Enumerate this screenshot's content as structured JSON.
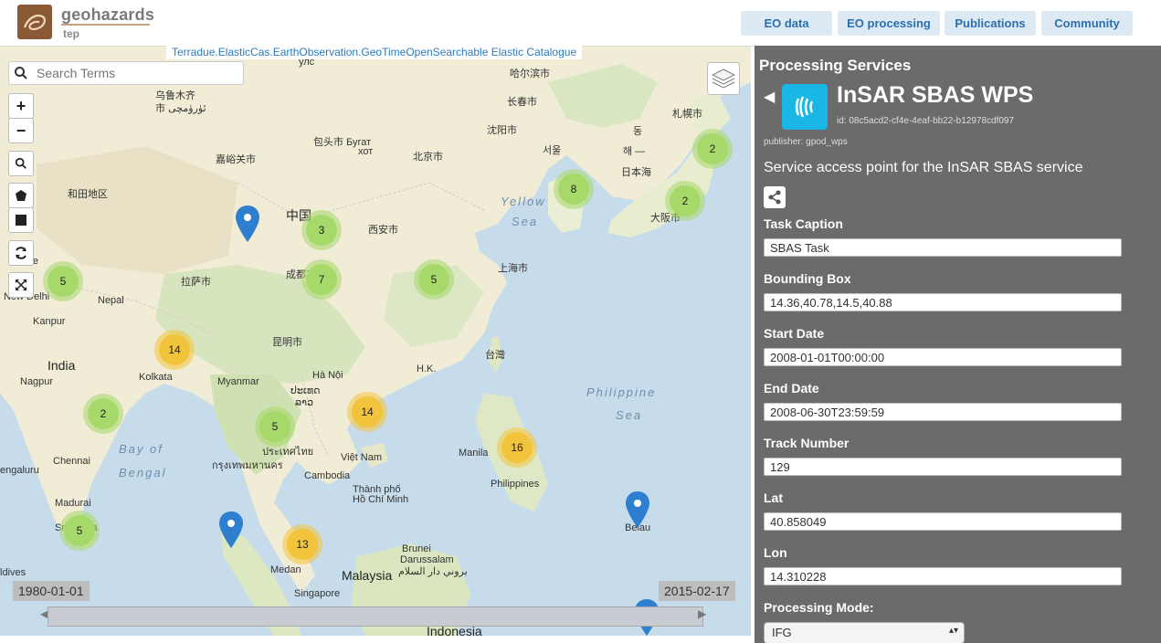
{
  "header": {
    "brand": "geohazards",
    "brand_sub": "tep",
    "nav": [
      "EO data",
      "EO processing",
      "Publications",
      "Community"
    ]
  },
  "map": {
    "catalog_label": "Terradue.ElasticCas.EarthObservation.GeoTimeOpenSearchable Elastic Catalogue",
    "search_placeholder": "Search Terms",
    "zoom_in": "+",
    "zoom_out": "−",
    "clusters": [
      "3",
      "7",
      "5",
      "5",
      "14",
      "2",
      "5",
      "14",
      "16",
      "8",
      "2",
      "2",
      "13",
      "5"
    ],
    "places": {
      "ulaanbaatar": "улс",
      "harbin": "哈尔滨市",
      "changchun": "长春市",
      "sapporo": "札幌市",
      "urumqi": "乌鲁木齐",
      "urumqi2": "市 ئۈرۈمچی",
      "shenyang": "沈阳市",
      "baotou": "包头市 Бугат",
      "baotou2": "хот",
      "beijing": "北京市",
      "dong": "동",
      "seoul": "서울",
      "haeh": "해 —",
      "japan_sea": "日本海",
      "jiayuguan": "嘉峪关市",
      "hotan": "和田地区",
      "china": "中国",
      "osaka": "大阪市",
      "xian": "西安市",
      "chengdu": "成都市",
      "shanghai": "上海市",
      "lhasa": "拉萨市",
      "nepal": "Nepal",
      "delhi": "New Delhi",
      "lahore": "hore",
      "kanpur": "Kanpur",
      "kunming": "昆明市",
      "taiwan": "台灣",
      "hk": "H.K.",
      "india": "India",
      "kolkata": "Kolkata",
      "myanmar": "Myanmar",
      "hanoi": "Hà Nội",
      "laos": "ປະເທດ",
      "laos2": "ລາວ",
      "nagpur": "Nagpur",
      "thailand": "ประเทศไทย",
      "bangkok": "กรุงเทพมหานคร",
      "vietnam": "Việt Nam",
      "manila": "Manila",
      "philippines": "Philippines",
      "cambodia": "Cambodia",
      "hcmc": "Thành phố",
      "hcmc2": "Hồ Chí Minh",
      "chennai": "Chennai",
      "bengaluru": "engaluru",
      "madurai": "Madurai",
      "srilanka": "Sri Lanka",
      "belau": "Belau",
      "brunei": "Brunei",
      "darussalam": "Darussalam",
      "brunei_ar": "بروني دار السلام",
      "medan": "Medan",
      "malaysia": "Malaysia",
      "singapore": "Singapore",
      "indonesia": "Indonesia",
      "maldives": "ldives",
      "yellow_sea": "Yellow",
      "yellow_sea2": "Sea",
      "philippine_sea": "Philippine",
      "philippine_sea2": "Sea",
      "bay_of_bengal": "Bay of",
      "bay_of_bengal2": "Bengal"
    },
    "date_start": "1980-01-01",
    "date_end": "2015-02-17"
  },
  "sidebar": {
    "title": "Processing Services",
    "service_name": "InSAR SBAS WPS",
    "service_id": "id: 08c5acd2-cf4e-4eaf-bb22-b12978cdf097",
    "publisher": "publisher: gpod_wps",
    "description": "Service access point for the InSAR SBAS service",
    "fields": [
      {
        "label": "Task Caption",
        "value": "SBAS Task"
      },
      {
        "label": "Bounding Box",
        "value": "14.36,40.78,14.5,40.88"
      },
      {
        "label": "Start Date",
        "value": "2008-01-01T00:00:00"
      },
      {
        "label": "End Date",
        "value": "2008-06-30T23:59:59"
      },
      {
        "label": "Track Number",
        "value": "129"
      },
      {
        "label": "Lat",
        "value": "40.858049"
      },
      {
        "label": "Lon",
        "value": "14.310228"
      }
    ],
    "mode_label": "Processing Mode:",
    "mode_value": "IFG"
  },
  "colors": {
    "sidebar_bg": "#6b6b6b",
    "nav_bg": "#dde9f3",
    "nav_text": "#2b6fb0",
    "service_icon": "#19b6e6",
    "cluster_green": "#a6d96a",
    "cluster_yellow": "#f2c43c",
    "pin": "#2f7fd0"
  },
  "icons": [
    "search-icon",
    "polygon-icon",
    "square-icon",
    "refresh-icon",
    "expand-icon",
    "layers-icon",
    "share-icon",
    "chevron-left-icon",
    "map-pin-icon",
    "wave-signal-icon"
  ]
}
